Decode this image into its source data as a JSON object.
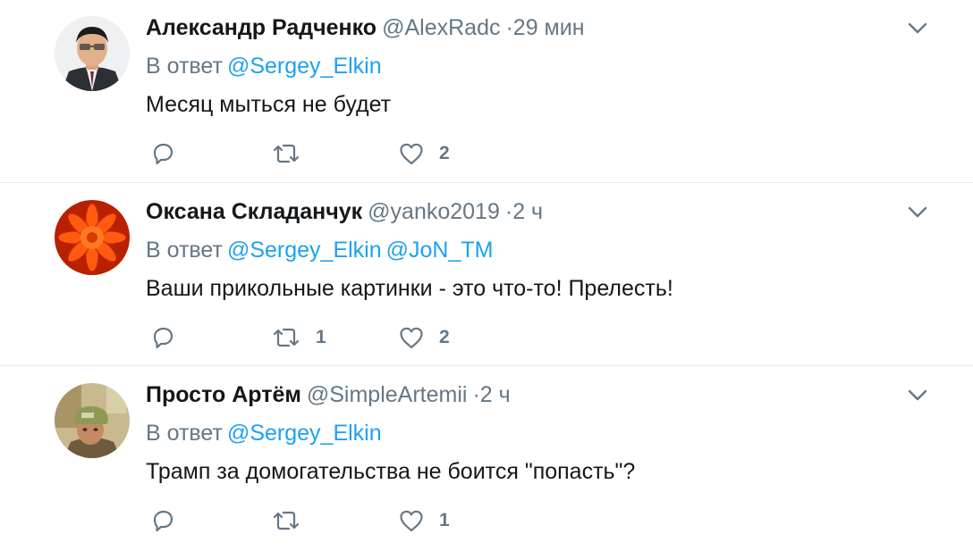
{
  "tweets": [
    {
      "name": "Александр Радченко",
      "handle": "@AlexRadc",
      "dot": "·",
      "time": "29 мин",
      "reply_label": "В ответ",
      "mentions": [
        "@Sergey_Elkin"
      ],
      "text": "Месяц мыться не будет",
      "counts": {
        "reply": "",
        "retweet": "",
        "like": "2"
      }
    },
    {
      "name": "Оксана Складанчук",
      "handle": "@yanko2019",
      "dot": "·",
      "time": "2 ч",
      "reply_label": "В ответ",
      "mentions": [
        "@Sergey_Elkin",
        "@JoN_TM"
      ],
      "text": "Ваши прикольные картинки - это что-то! Прелесть!",
      "counts": {
        "reply": "",
        "retweet": "1",
        "like": "2"
      }
    },
    {
      "name": "Просто Артём",
      "handle": "@SimpleArtemii",
      "dot": "·",
      "time": "2 ч",
      "reply_label": "В ответ",
      "mentions": [
        "@Sergey_Elkin"
      ],
      "text": "Трамп за домогательства не боится \"попасть\"?",
      "counts": {
        "reply": "",
        "retweet": "",
        "like": "1"
      }
    }
  ],
  "icons": {
    "reply": "reply-icon",
    "retweet": "retweet-icon",
    "like": "heart-icon",
    "menu": "chevron-down-icon"
  },
  "colors": {
    "name": "#14171a",
    "secondary": "#657786",
    "link": "#1da1f2",
    "divider": "#e6ecf0"
  }
}
